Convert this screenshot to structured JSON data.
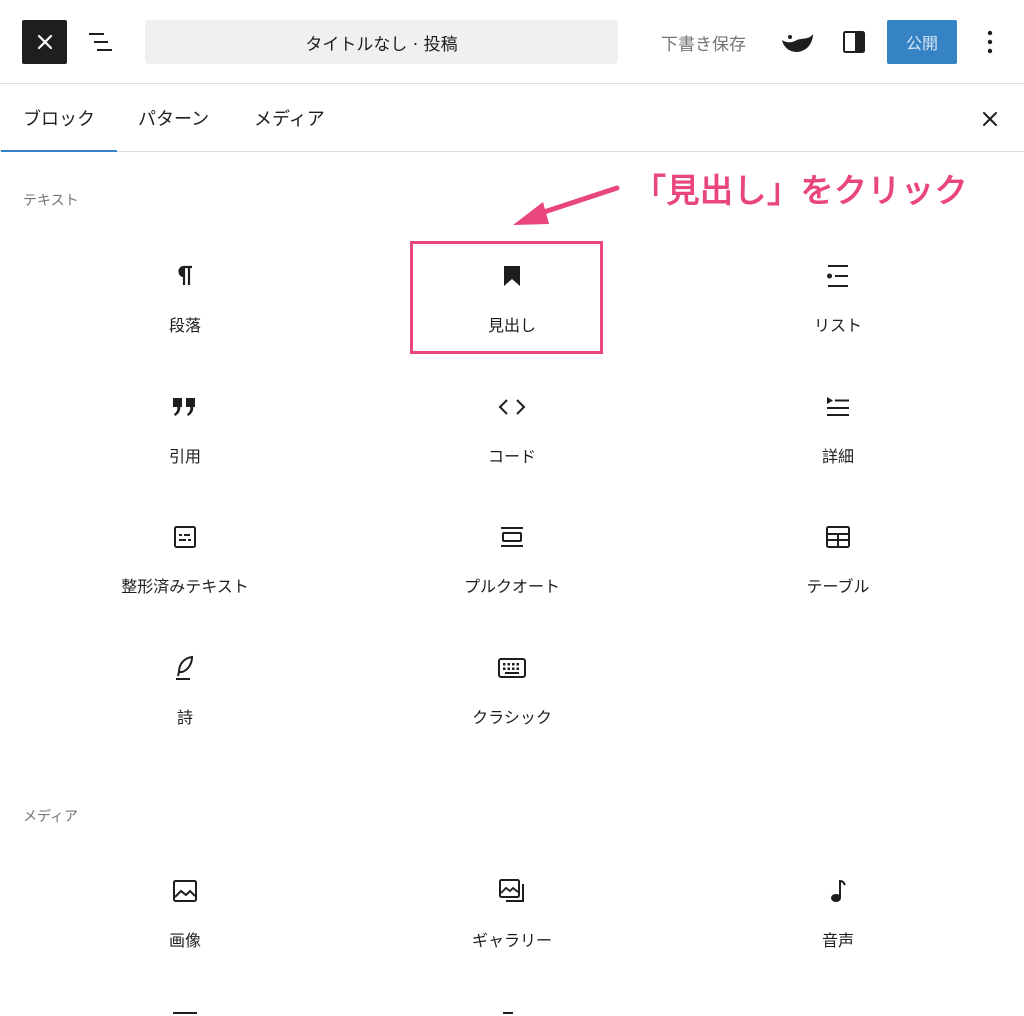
{
  "toolbar": {
    "document_title": "タイトルなし · 投稿",
    "save_draft_label": "下書き保存",
    "publish_label": "公開"
  },
  "tabs": [
    {
      "label": "ブロック",
      "active": true
    },
    {
      "label": "パターン",
      "active": false
    },
    {
      "label": "メディア",
      "active": false
    }
  ],
  "sections": {
    "text": {
      "heading": "テキスト",
      "blocks": [
        {
          "label": "段落",
          "icon": "paragraph-icon"
        },
        {
          "label": "見出し",
          "icon": "bookmark-icon"
        },
        {
          "label": "リスト",
          "icon": "list-icon"
        },
        {
          "label": "引用",
          "icon": "quote-icon"
        },
        {
          "label": "コード",
          "icon": "code-icon"
        },
        {
          "label": "詳細",
          "icon": "details-icon"
        },
        {
          "label": "整形済みテキスト",
          "icon": "preformatted-icon"
        },
        {
          "label": "プルクオート",
          "icon": "pullquote-icon"
        },
        {
          "label": "テーブル",
          "icon": "table-icon"
        },
        {
          "label": "詩",
          "icon": "feather-icon"
        },
        {
          "label": "クラシック",
          "icon": "keyboard-icon"
        }
      ]
    },
    "media": {
      "heading": "メディア",
      "blocks": [
        {
          "label": "画像",
          "icon": "image-icon"
        },
        {
          "label": "ギャラリー",
          "icon": "gallery-icon"
        },
        {
          "label": "音声",
          "icon": "audio-icon"
        }
      ]
    }
  },
  "annotation": {
    "text": "「見出し」をクリック",
    "color": "#e8467c"
  },
  "colors": {
    "accent": "#3582c4",
    "text": "#1e1e1e",
    "muted": "#757575"
  }
}
